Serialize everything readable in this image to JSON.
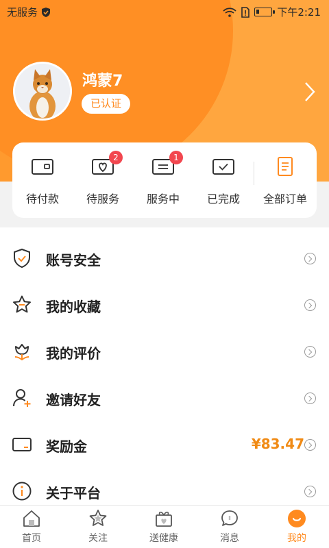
{
  "status_bar": {
    "carrier": "无服务",
    "time": "下午2:21"
  },
  "profile": {
    "username": "鸿蒙7",
    "verified_label": "已认证"
  },
  "orders": [
    {
      "label": "待付款",
      "icon": "wallet-icon"
    },
    {
      "label": "待服务",
      "icon": "heart-box-icon",
      "badge": "2"
    },
    {
      "label": "服务中",
      "icon": "service-icon",
      "badge": "1"
    },
    {
      "label": "已完成",
      "icon": "check-box-icon"
    },
    {
      "label": "全部订单",
      "icon": "document-icon"
    }
  ],
  "menu": [
    {
      "label": "账号安全",
      "icon": "shield-check-icon"
    },
    {
      "label": "我的收藏",
      "icon": "star-icon"
    },
    {
      "label": "我的评价",
      "icon": "tulip-icon"
    },
    {
      "label": "邀请好友",
      "icon": "add-user-icon"
    },
    {
      "label": "奖励金",
      "icon": "wallet-icon",
      "value": "¥83.47"
    },
    {
      "label": "关于平台",
      "icon": "info-icon"
    }
  ],
  "tabs": [
    {
      "label": "首页",
      "icon": "home-icon"
    },
    {
      "label": "关注",
      "icon": "star-icon"
    },
    {
      "label": "送健康",
      "icon": "gift-icon"
    },
    {
      "label": "消息",
      "icon": "message-icon"
    },
    {
      "label": "我的",
      "icon": "profile-icon",
      "active": true
    }
  ],
  "colors": {
    "accent": "#ff8a1f",
    "header": "#ff9a2e",
    "badge": "#f2474f",
    "reward": "#f08a14"
  }
}
